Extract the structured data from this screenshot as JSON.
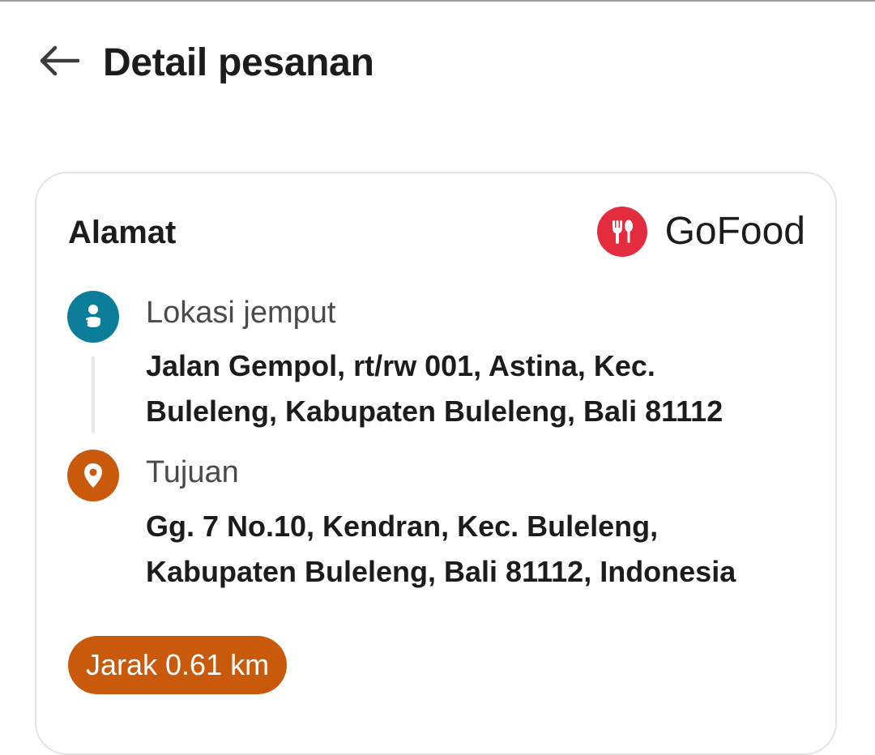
{
  "header": {
    "back_icon": "arrow-left-icon",
    "title": "Detail pesanan"
  },
  "address_card": {
    "title": "Alamat",
    "service": {
      "logo_icon": "fork-spoon-icon",
      "name": "GoFood",
      "color": "#e32d3e"
    },
    "pickup": {
      "icon": "person-pin-icon",
      "label": "Lokasi jemput",
      "address_line1": "Jalan Gempol, rt/rw 001, Astina, Kec.",
      "address_line2": "Buleleng, Kabupaten Buleleng, Bali 81112",
      "color": "#0b7d99"
    },
    "destination": {
      "icon": "location-pin-icon",
      "label": "Tujuan",
      "address_line1": "Gg. 7 No.10, Kendran, Kec. Buleleng,",
      "address_line2": "Kabupaten Buleleng, Bali 81112, Indonesia",
      "color": "#c95a0c"
    },
    "distance_badge": "Jarak 0.61 km"
  }
}
